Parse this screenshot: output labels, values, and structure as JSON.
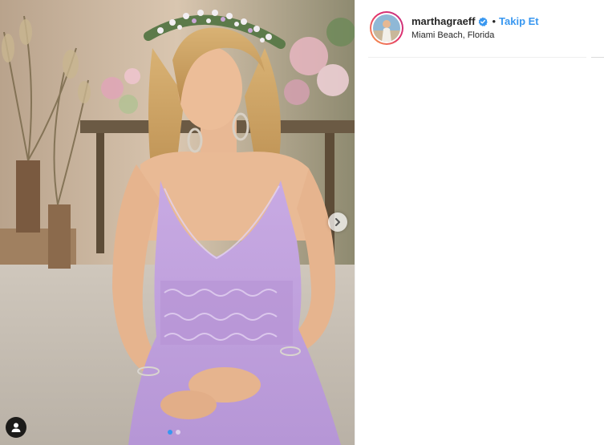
{
  "post": {
    "username": "marthagraeff",
    "verified": true,
    "separator": "•",
    "follow_label": "Takip Et",
    "location": "Miami Beach, Florida"
  },
  "media": {
    "image": "woman-in-lavender-dress-with-flower-crown",
    "carousel_current": 1,
    "carousel_total": 2
  },
  "colors": {
    "follow_blue": "#3897f0",
    "verified_blue": "#3897f0",
    "dress_lavender": "#c4a6e0"
  },
  "icons": {
    "next": "chevron-right-icon",
    "user_tag": "user-icon",
    "verified": "verified-badge-icon"
  }
}
